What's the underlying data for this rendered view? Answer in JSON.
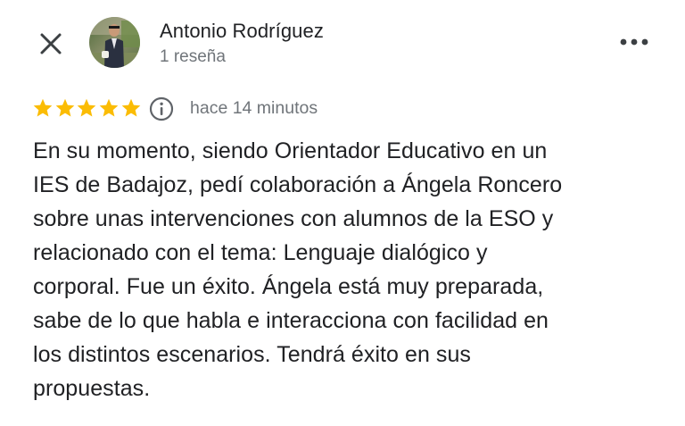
{
  "header": {
    "close_icon": "close-icon",
    "avatar_icon": "profile-photo",
    "author_name": "Antonio Rodríguez",
    "review_count": "1 reseña",
    "more_icon": "more-horizontal-icon"
  },
  "review": {
    "rating": 5,
    "rating_max": 5,
    "star_color": "#fbbc04",
    "info_icon": "info-icon",
    "timestamp": "hace 14 minutos",
    "text_lines": [
      "En su momento, siendo Orientador Educativo en un",
      "IES de Badajoz, pedí colaboración a Ángela Roncero",
      "sobre unas intervenciones con alumnos de la ESO y",
      "relacionado con el tema: Lenguaje dialógico y",
      "corporal. Fue un éxito. Ángela está muy preparada,",
      "sabe de lo que habla e interacciona con facilidad en",
      "los distintos escenarios. Tendrá éxito en sus",
      "propuestas."
    ]
  },
  "colors": {
    "text_primary": "#202124",
    "text_secondary": "#70757a",
    "icon": "#3c4043"
  }
}
